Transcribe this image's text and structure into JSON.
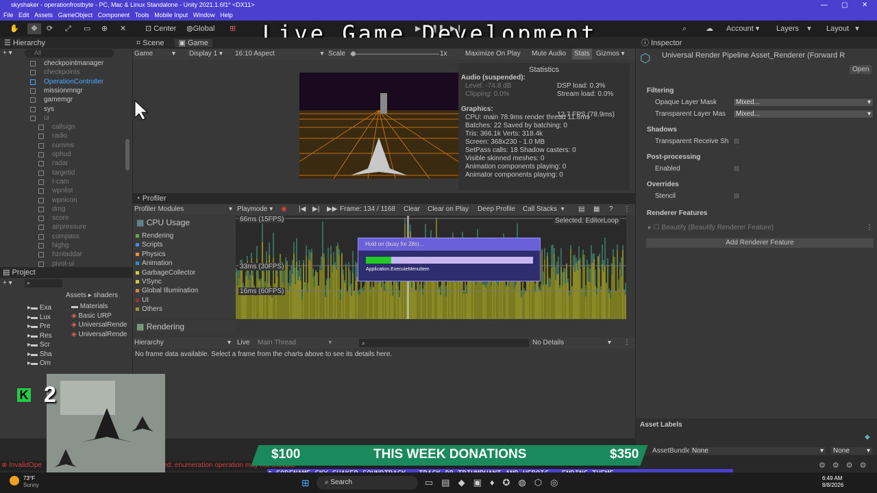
{
  "window": {
    "title": "skyshaker - operationfrostbyte - PC, Mac & Linux Standalone - Unity 2021.1.6f1* <DX11>"
  },
  "menu": [
    "File",
    "Edit",
    "Assets",
    "GameObject",
    "Component",
    "Tools",
    "Mobile Input",
    "Window",
    "Help"
  ],
  "toolbar": {
    "center": "Center",
    "global": "Global",
    "account": "Account",
    "layers": "Layers",
    "layout": "Layout"
  },
  "overlay": {
    "title": "Live Game Development"
  },
  "hierarchy": {
    "tab": "Hierarchy",
    "search_placeholder": "All",
    "items": [
      {
        "label": "checkpointmanager",
        "dim": false
      },
      {
        "label": "checkpoints",
        "dim": true
      },
      {
        "label": "OperationController",
        "dim": false,
        "selected": true
      },
      {
        "label": "missionmngr",
        "dim": false
      },
      {
        "label": "gamemgr",
        "dim": false
      },
      {
        "label": "sys",
        "dim": false
      },
      {
        "label": "ui",
        "dim": true
      },
      {
        "label": "callsign",
        "dim": true
      },
      {
        "label": "radio",
        "dim": true
      },
      {
        "label": "comms",
        "dim": true
      },
      {
        "label": "ophud",
        "dim": true
      },
      {
        "label": "radar",
        "dim": true
      },
      {
        "label": "targetid",
        "dim": true
      },
      {
        "label": "t-cam",
        "dim": true
      },
      {
        "label": "wpnlist",
        "dim": true
      },
      {
        "label": "wpnicon",
        "dim": true
      },
      {
        "label": "dmg",
        "dim": true
      },
      {
        "label": "score",
        "dim": true
      },
      {
        "label": "airpressure",
        "dim": true
      },
      {
        "label": "compass",
        "dim": true
      },
      {
        "label": "highg",
        "dim": true
      },
      {
        "label": "hznladdar",
        "dim": true
      },
      {
        "label": "pivot-ui",
        "dim": true
      }
    ]
  },
  "scene_tabs": {
    "scene": "Scene",
    "game": "Game"
  },
  "game_bar": {
    "mode": "Game",
    "display": "Display 1",
    "aspect": "16:10 Aspect",
    "scale_label": "Scale",
    "scale_value": "1x",
    "maximize": "Maximize On Play",
    "mute": "Mute Audio",
    "stats": "Stats",
    "gizmos": "Gizmos"
  },
  "stats": {
    "title": "Statistics",
    "audio_head": "Audio (suspended):",
    "level": "Level: -74.8 dB",
    "clipping": "Clipping: 0.0%",
    "dsp": "DSP load: 0.3%",
    "stream": "Stream load: 0.0%",
    "graphics_head": "Graphics:",
    "fps": "12.7 FPS (78.9ms)",
    "cpu": "CPU: main 78.9ms  render thread 11.8ms",
    "batches": "Batches: 22    Saved by batching: 0",
    "tris": "Tris: 366.1k    Verts: 318.4k",
    "screen": "Screen: 368x230 - 1.0 MB",
    "setpass": "SetPass calls: 18        Shadow casters: 0",
    "skinned": "Visible skinned meshes: 0",
    "anim": "Animation components playing: 0",
    "animator": "Animator components playing: 0"
  },
  "profiler": {
    "tab": "Profiler",
    "modules": "Profiler Modules",
    "playmode": "Playmode",
    "frame": "Frame: 134 / 1168",
    "clear": "Clear",
    "clear_on_play": "Clear on Play",
    "deep": "Deep Profile",
    "call_stacks": "Call Stacks",
    "cpu_usage": "CPU Usage",
    "selected": "Selected: EditorLoop",
    "fps15": "66ms (15FPS)",
    "fps30": "33ms (30FPS)",
    "fps60": "16ms (60FPS)",
    "rendering_module": "Rendering",
    "hierarchy": "Hierarchy",
    "live": "Live",
    "main_thread": "Main Thread",
    "no_details": "No Details",
    "no_data": "No frame data available. Select a frame from the charts above to see its details here.",
    "modules_list": [
      {
        "label": "Rendering",
        "color": "#6aa84f"
      },
      {
        "label": "Scripts",
        "color": "#4a86e8"
      },
      {
        "label": "Physics",
        "color": "#e69138"
      },
      {
        "label": "Animation",
        "color": "#3d85c6"
      },
      {
        "label": "GarbageCollector",
        "color": "#cccc33"
      },
      {
        "label": "VSync",
        "color": "#cccc33"
      },
      {
        "label": "Global Illumination",
        "color": "#cc8844"
      },
      {
        "label": "UI",
        "color": "#993333"
      },
      {
        "label": "Others",
        "color": "#999933"
      }
    ]
  },
  "progress": {
    "title": "Hold on (busy for 28s)...",
    "value": 0.15,
    "message": "Application.ExecuteMenuItem"
  },
  "project": {
    "tab": "Project",
    "breadcrumb_assets": "Assets",
    "breadcrumb_shaders": "shaders",
    "tree": [
      "Exa",
      "Lux",
      "Pre",
      "Res",
      "Scr",
      "Sha",
      "Om"
    ],
    "files": [
      "Materials",
      "Basic URP",
      "UniversalRende",
      "UniversalRende"
    ]
  },
  "inspector": {
    "tab": "Inspector",
    "title": "Universal Render Pipeline Asset_Renderer (Forward R",
    "open": "Open",
    "filtering": "Filtering",
    "opaque": "Opaque Layer Mask",
    "transparent": "Transparent Layer Mas",
    "mixed": "Mixed...",
    "shadows": "Shadows",
    "transparent_receive": "Transparent Receive Sh",
    "post": "Post-processing",
    "enabled": "Enabled",
    "overrides": "Overrides",
    "stencil": "Stencil",
    "features": "Renderer Features",
    "beautify": "Beautify (Beautify Renderer Feature)",
    "add_feature": "Add Renderer Feature",
    "asset_labels": "Asset Labels",
    "bundle": "AssetBundle",
    "none1": "None",
    "none2": "None"
  },
  "stream": {
    "donation_left": "$100",
    "donation_title": "THIS WEEK DONATIONS",
    "donation_right": "$350",
    "soundtrack": "CODENAME SKY SHAKER SOUNDTRACK - TRACK 08 TRIUMPHANT AND HEROIC - ENDING THEME",
    "cam_number": "2"
  },
  "console": {
    "error": "InvalidOpe",
    "error2": "ified; enumeration operation may not execute"
  },
  "taskbar": {
    "weather_temp": "73°F",
    "weather_cond": "Sunny",
    "search": "Search",
    "time": "6:49 AM",
    "date": "8/8/2026"
  }
}
